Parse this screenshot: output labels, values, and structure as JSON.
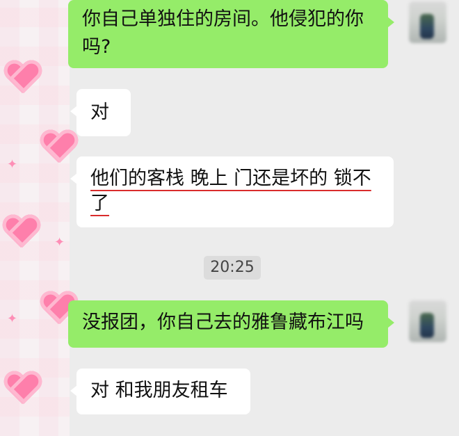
{
  "messages": [
    {
      "side": "out",
      "text": "你自己单独住的房间。他侵犯的你吗?"
    },
    {
      "side": "in",
      "text": "对"
    },
    {
      "side": "in",
      "line1": "他们的客栈 晚上 门还是坏的 锁不",
      "line2": "了"
    },
    {
      "side": "time",
      "text": "20:25"
    },
    {
      "side": "out",
      "text": "没报团，你自己去的雅鲁藏布江吗"
    },
    {
      "side": "in",
      "text": "对 和我朋友租车"
    }
  ],
  "colors": {
    "outgoing_bubble": "#95ec69",
    "incoming_bubble": "#ffffff",
    "background": "#ececec",
    "underline": "#d92b2b"
  }
}
